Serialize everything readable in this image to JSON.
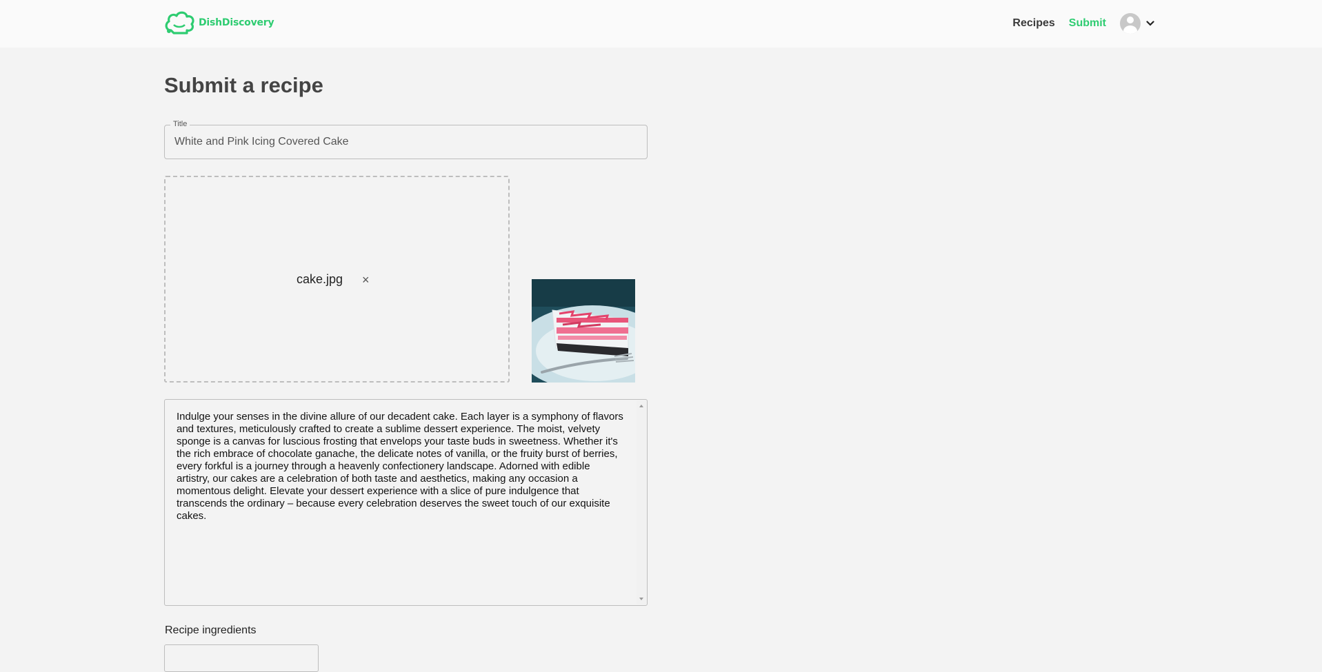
{
  "header": {
    "brand": "DishDiscovery",
    "nav": [
      {
        "label": "Recipes",
        "active": false
      },
      {
        "label": "Submit",
        "active": true
      }
    ],
    "accent_color": "#2ecc71"
  },
  "page": {
    "title": "Submit a recipe"
  },
  "form": {
    "title_label": "Title",
    "title_value": "White and Pink Icing Covered Cake",
    "upload": {
      "file_name": "cake.jpg",
      "remove_icon": "×"
    },
    "description": "Indulge your senses in the divine allure of our decadent cake. Each layer is a symphony of flavors and textures, meticulously crafted to create a sublime dessert experience. The moist, velvety sponge is a canvas for luscious frosting that envelops your taste buds in sweetness. Whether it's the rich embrace of chocolate ganache, the delicate notes of vanilla, or the fruity burst of berries, every forkful is a journey through a heavenly confectionery landscape. Adorned with edible artistry, our cakes are a celebration of both taste and aesthetics, making any occasion a momentous delight. Elevate your dessert experience with a slice of pure indulgence that transcends the ordinary – because every celebration deserves the sweet touch of our exquisite cakes.",
    "ingredients_label": "Recipe ingredients"
  }
}
